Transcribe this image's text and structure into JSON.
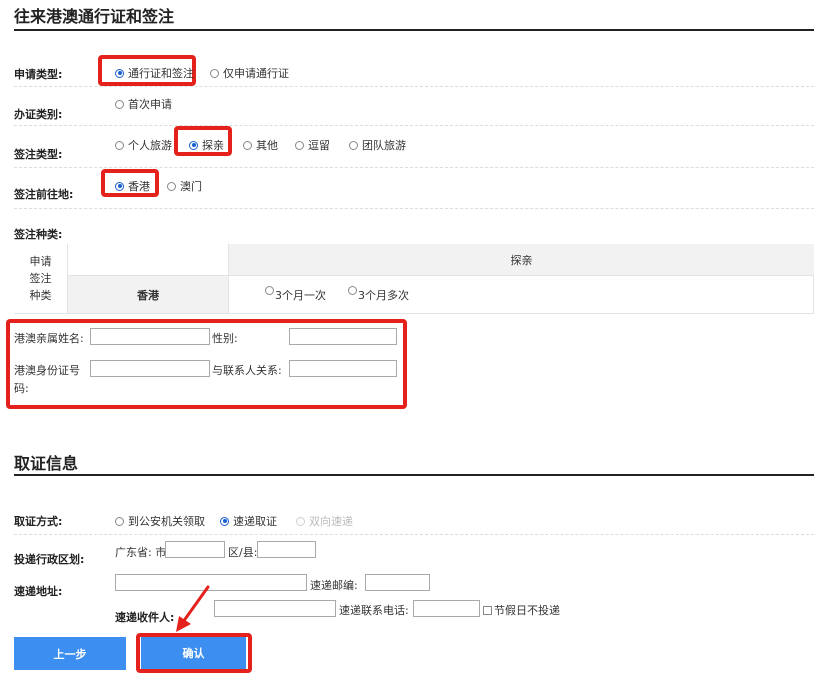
{
  "section1": {
    "title": "往来港澳通行证和签注",
    "apply_type": {
      "label": "申请类型:",
      "options": [
        {
          "text": "通行证和签注",
          "checked": true
        },
        {
          "text": "仅申请通行证",
          "checked": false
        }
      ]
    },
    "cert_category": {
      "label": "办证类别:",
      "options": [
        {
          "text": "首次申请",
          "checked": false
        }
      ]
    },
    "endorse_type": {
      "label": "签注类型:",
      "options": [
        {
          "text": "个人旅游",
          "checked": false
        },
        {
          "text": "探亲",
          "checked": true
        },
        {
          "text": "其他",
          "checked": false
        },
        {
          "text": "逗留",
          "checked": false
        },
        {
          "text": "团队旅游",
          "checked": false
        }
      ]
    },
    "destination": {
      "label": "签注前往地:",
      "options": [
        {
          "text": "香港",
          "checked": true
        },
        {
          "text": "澳门",
          "checked": false
        }
      ]
    },
    "endorse_kind": {
      "label": "签注种类:",
      "table": {
        "row_head_lines": [
          "申请",
          "签注",
          "种类"
        ],
        "header": "探亲",
        "place": "香港",
        "options": [
          {
            "text": "3个月一次",
            "checked": false
          },
          {
            "text": "3个月多次",
            "checked": false
          }
        ]
      }
    },
    "relative": {
      "name_label": "港澳亲属姓名:",
      "name_value": "",
      "gender_label": "性别:",
      "gender_value": "",
      "id_label_line1": "港澳身份证号",
      "id_label_line2": "码:",
      "id_value": "",
      "relation_label": "与联系人关系:",
      "relation_value": ""
    }
  },
  "section2": {
    "title": "取证信息",
    "method": {
      "label": "取证方式:",
      "options": [
        {
          "text": "到公安机关领取",
          "checked": false,
          "disabled": false
        },
        {
          "text": "速递取证",
          "checked": true,
          "disabled": false
        },
        {
          "text": "双向速递",
          "checked": false,
          "disabled": true
        }
      ]
    },
    "region": {
      "label": "投递行政区划:",
      "province_city": "广东省: 市:",
      "district": "区/县:",
      "city_value": "",
      "district_value": ""
    },
    "address": {
      "label": "速递地址:",
      "value": "",
      "postcode_label": "速递邮编:",
      "postcode_value": ""
    },
    "recipient": {
      "label": "速递收件人:",
      "value": "",
      "phone_label": "速递联系电话:",
      "phone_value": "",
      "holiday_label": "节假日不投递"
    }
  },
  "buttons": {
    "prev": "上一步",
    "confirm": "确认"
  },
  "colors": {
    "highlight": "#e5211c",
    "button": "#3c8ef0",
    "radio_checked": "#1a5fd0",
    "table_head_bg": "#f2f2f2"
  }
}
